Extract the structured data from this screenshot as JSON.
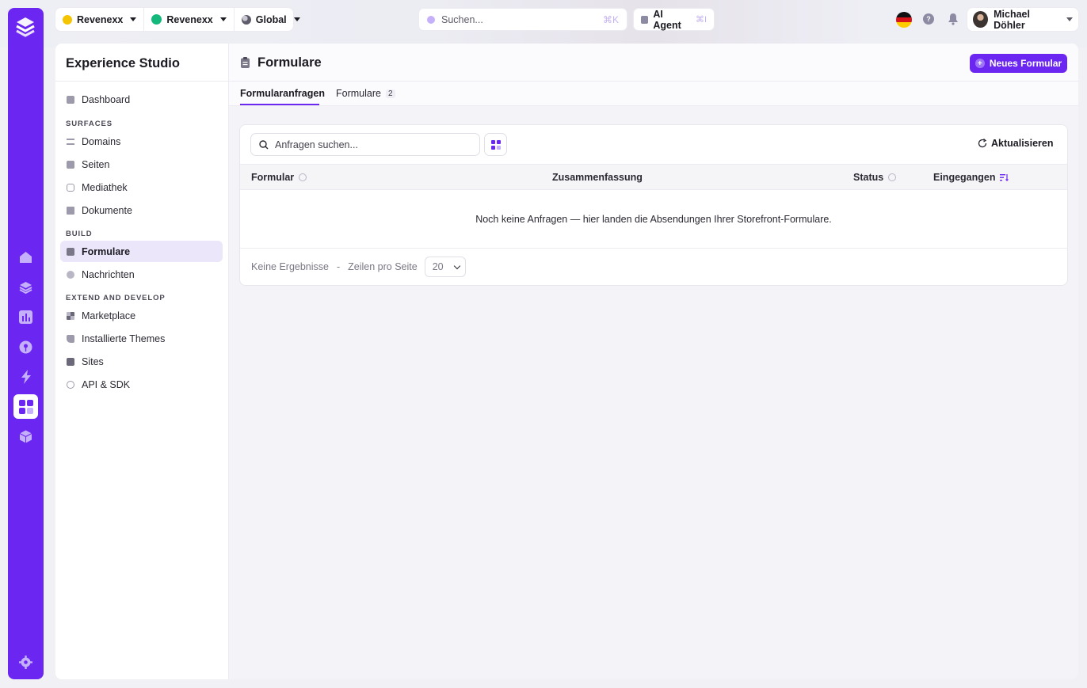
{
  "topbar": {
    "org": "Revenexx",
    "store": "Revenexx",
    "region": "Global",
    "search_placeholder": "Suchen...",
    "search_shortcut": "⌘K",
    "agent_label": "AI Agent",
    "agent_shortcut": "⌘I",
    "help_label": "?",
    "user_name": "Michael Döhler"
  },
  "sidebar": {
    "title": "Experience Studio",
    "dashboard": "Dashboard",
    "sections": {
      "surfaces": "SURFACES",
      "build": "BUILD",
      "extend": "EXTEND AND DEVELOP"
    },
    "surfaces_items": [
      "Domains",
      "Seiten",
      "Mediathek",
      "Dokumente"
    ],
    "build_items": [
      "Formulare",
      "Nachrichten"
    ],
    "extend_items": [
      "Marketplace",
      "Installierte Themes",
      "Sites",
      "API & SDK"
    ]
  },
  "main": {
    "title": "Formulare",
    "new_button": "Neues Formular",
    "tabs": [
      {
        "label": "Formularanfragen"
      },
      {
        "label": "Formulare",
        "count": "2"
      }
    ],
    "search_placeholder": "Anfragen suchen...",
    "refresh_label": "Aktualisieren",
    "columns": [
      "Formular",
      "Zusammenfassung",
      "Status",
      "Eingegangen"
    ],
    "empty_message": "Noch keine Anfragen — hier landen die Absendungen Ihrer Storefront-Formulare.",
    "footer": {
      "results": "Keine Ergebnisse",
      "separator": "-",
      "rows_label": "Zeilen pro Seite",
      "rows_value": "20"
    }
  },
  "colors": {
    "accent": "#6b26f2",
    "active_item_bg": "#ece6fb"
  },
  "icons": [
    "logo-icon",
    "home-icon",
    "layers-icon",
    "chart-icon",
    "pin-icon",
    "bolt-icon",
    "apps-icon",
    "box-icon",
    "settings-icon",
    "search-icon",
    "refresh-icon",
    "grid-icon",
    "bell-icon",
    "flag-icon"
  ]
}
